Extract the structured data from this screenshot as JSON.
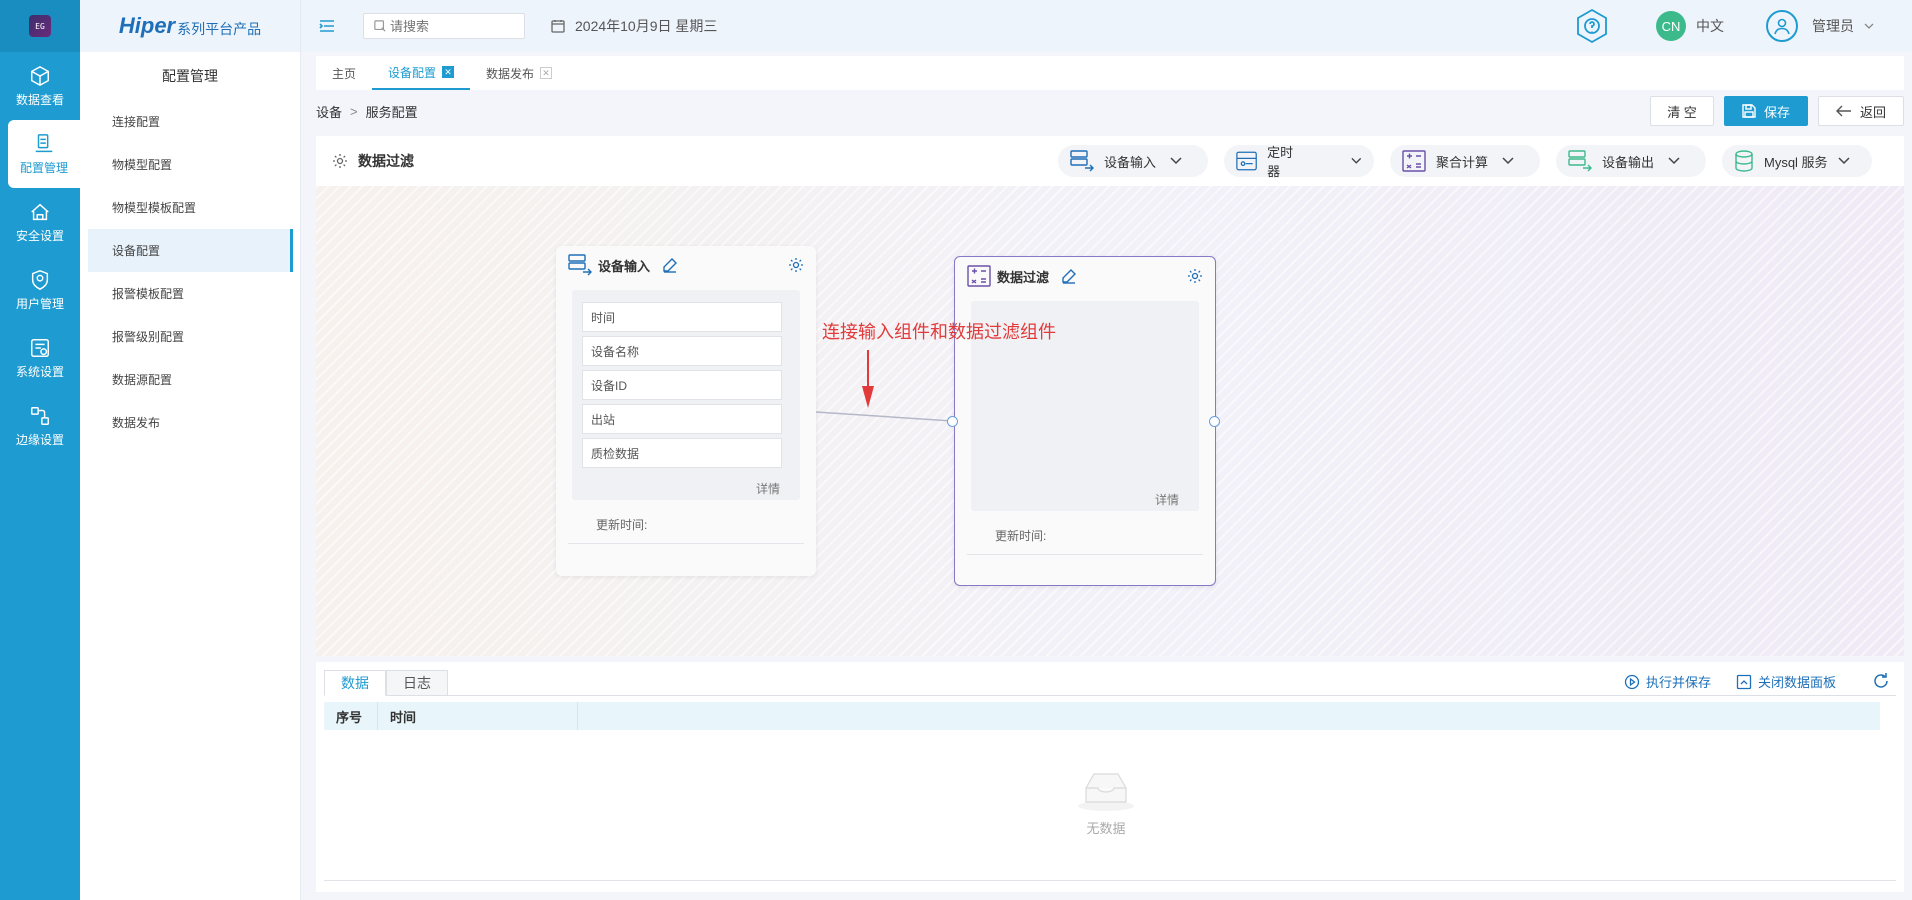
{
  "rail": {
    "logo_text": "EG",
    "items": [
      {
        "label": "数据查看",
        "icon": "cube-icon"
      },
      {
        "label": "配置管理",
        "icon": "config-icon",
        "active": true
      },
      {
        "label": "安全设置",
        "icon": "security-icon"
      },
      {
        "label": "用户管理",
        "icon": "user-shield-icon"
      },
      {
        "label": "系统设置",
        "icon": "system-icon"
      },
      {
        "label": "边缘设置",
        "icon": "edge-icon"
      }
    ]
  },
  "brand": {
    "name": "Hiper",
    "suffix": "系列平台产品"
  },
  "sidebar": {
    "title": "配置管理",
    "items": [
      {
        "label": "连接配置"
      },
      {
        "label": "物模型配置"
      },
      {
        "label": "物模型模板配置"
      },
      {
        "label": "设备配置",
        "active": true
      },
      {
        "label": "报警模板配置"
      },
      {
        "label": "报警级别配置"
      },
      {
        "label": "数据源配置"
      },
      {
        "label": "数据发布"
      }
    ]
  },
  "header": {
    "search_placeholder": "请搜索",
    "date": "2024年10月9日 星期三",
    "lang_badge": "CN",
    "lang_label": "中文",
    "user_label": "管理员"
  },
  "tabs": [
    {
      "label": "主页"
    },
    {
      "label": "设备配置",
      "active": true
    },
    {
      "label": "数据发布"
    }
  ],
  "breadcrumb": {
    "root": "设备",
    "separator": ">",
    "current": "服务配置"
  },
  "actions": {
    "clear": "清 空",
    "save": "保存",
    "back": "返回"
  },
  "panel": {
    "title": "数据过滤",
    "tools": [
      {
        "label": "设备输入"
      },
      {
        "label": "定时器"
      },
      {
        "label": "聚合计算"
      },
      {
        "label": "设备输出"
      },
      {
        "label": "Mysql 服务"
      }
    ]
  },
  "nodes": {
    "input": {
      "title": "设备输入",
      "fields": [
        "时间",
        "设备名称",
        "设备ID",
        "出站",
        "质检数据"
      ],
      "detail": "详情",
      "update_label": "更新时间:"
    },
    "filter": {
      "title": "数据过滤",
      "detail": "详情",
      "update_label": "更新时间:"
    }
  },
  "annotation": "连接输入组件和数据过滤组件",
  "data_panel": {
    "tabs": [
      {
        "label": "数据",
        "active": true
      },
      {
        "label": "日志"
      }
    ],
    "exec_save": "执行并保存",
    "close_panel": "关闭数据面板",
    "columns": [
      "序号",
      "时间"
    ],
    "empty_text": "无数据"
  },
  "colors": {
    "primary": "#1e9bd0",
    "annotation": "#e23a3a",
    "selected_border": "#8878c8"
  }
}
